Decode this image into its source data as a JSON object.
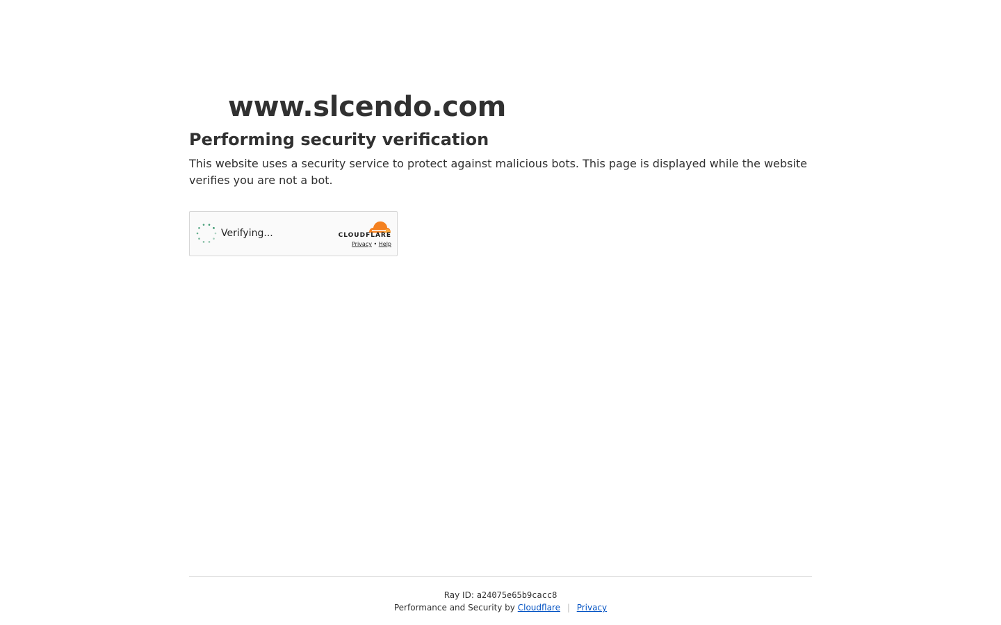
{
  "site": {
    "title": "www.slcendo.com"
  },
  "main": {
    "heading": "Performing security verification",
    "description": "This website uses a security service to protect against malicious bots. This page is displayed while the website verifies you are not a bot."
  },
  "widget": {
    "status": "Verifying...",
    "brand": "CLOUDFLARE",
    "privacy_link": "Privacy",
    "link_separator": "•",
    "help_link": "Help",
    "accent_color": "#f48120",
    "spinner_color": "#1f8a5b"
  },
  "footer": {
    "ray_label": "Ray ID:",
    "ray_id": "a24075e65b9cacc8",
    "performance_text": "Performance and Security by",
    "cloudflare_link": "Cloudflare",
    "separator": "|",
    "privacy_link": "Privacy",
    "link_color": "#0051c3"
  }
}
